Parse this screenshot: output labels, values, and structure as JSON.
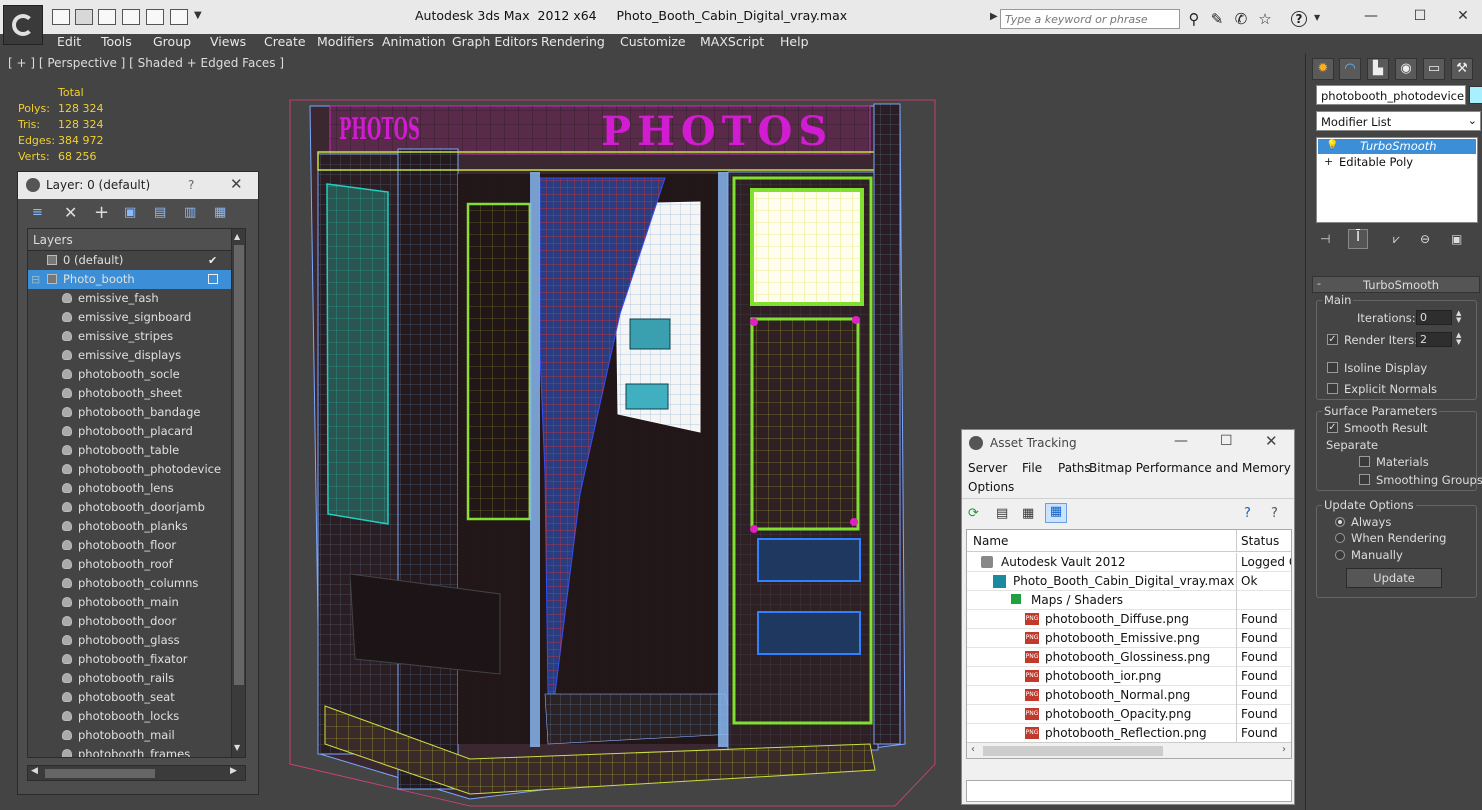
{
  "app": {
    "title_left": "Autodesk 3ds Max  2012 x64",
    "title_file": "Photo_Booth_Cabin_Digital_vray.max",
    "search_placeholder": "Type a keyword or phrase"
  },
  "menu": [
    "Edit",
    "Tools",
    "Group",
    "Views",
    "Create",
    "Modifiers",
    "Animation",
    "Graph Editors",
    "Rendering",
    "Customize",
    "MAXScript",
    "Help"
  ],
  "viewport": {
    "label": "[ + ] [ Perspective ] [ Shaded + Edged Faces ]",
    "stats": {
      "header": "Total",
      "rows": [
        {
          "label": "Polys:",
          "value": "128 324"
        },
        {
          "label": "Tris:",
          "value": "128 324"
        },
        {
          "label": "Edges:",
          "value": "384 972"
        },
        {
          "label": "Verts:",
          "value": "68 256"
        }
      ]
    },
    "sign_text": "PHOTOS",
    "side_sign_text": "PHOTOS"
  },
  "layer_panel": {
    "title": "Layer: 0 (default)",
    "help": "?",
    "column_header": "Layers",
    "rows": [
      {
        "label": "0 (default)",
        "level": 1
      },
      {
        "label": "Photo_booth",
        "level": 1
      },
      {
        "label": "emissive_fash",
        "level": 2
      },
      {
        "label": "emissive_signboard",
        "level": 2
      },
      {
        "label": "emissive_stripes",
        "level": 2
      },
      {
        "label": "emissive_displays",
        "level": 2
      },
      {
        "label": "photobooth_socle",
        "level": 2
      },
      {
        "label": "photobooth_sheet",
        "level": 2
      },
      {
        "label": "photobooth_bandage",
        "level": 2
      },
      {
        "label": "photobooth_placard",
        "level": 2
      },
      {
        "label": "photobooth_table",
        "level": 2
      },
      {
        "label": "photobooth_photodevice",
        "level": 2
      },
      {
        "label": "photobooth_lens",
        "level": 2
      },
      {
        "label": "photobooth_doorjamb",
        "level": 2
      },
      {
        "label": "photobooth_planks",
        "level": 2
      },
      {
        "label": "photobooth_floor",
        "level": 2
      },
      {
        "label": "photobooth_roof",
        "level": 2
      },
      {
        "label": "photobooth_columns",
        "level": 2
      },
      {
        "label": "photobooth_main",
        "level": 2
      },
      {
        "label": "photobooth_door",
        "level": 2
      },
      {
        "label": "photobooth_glass",
        "level": 2
      },
      {
        "label": "photobooth_fixator",
        "level": 2
      },
      {
        "label": "photobooth_rails",
        "level": 2
      },
      {
        "label": "photobooth_seat",
        "level": 2
      },
      {
        "label": "photobooth_locks",
        "level": 2
      },
      {
        "label": "photobooth_mail",
        "level": 2
      },
      {
        "label": "photobooth_frames",
        "level": 2
      }
    ],
    "selected_row": "Photo_booth"
  },
  "command_panel": {
    "object_name": "photobooth_photodevice",
    "modifier_list": "Modifier List",
    "stack": [
      "TurboSmooth",
      "Editable Poly"
    ],
    "rollout_title": "TurboSmooth",
    "main_label": "Main",
    "iterations_label": "Iterations:",
    "iterations_value": "0",
    "render_iters_label": "Render Iters:",
    "render_iters_value": "2",
    "render_iters_checked": true,
    "isoline_label": "Isoline Display",
    "explicit_normals_label": "Explicit Normals",
    "surface_params_label": "Surface Parameters",
    "smooth_result_label": "Smooth Result",
    "smooth_result_checked": true,
    "separate_label": "Separate",
    "materials_label": "Materials",
    "smoothing_groups_label": "Smoothing Groups",
    "update_options_label": "Update Options",
    "update_always": "Always",
    "update_when_rendering": "When Rendering",
    "update_manually": "Manually",
    "update_selected": "Always",
    "update_button": "Update"
  },
  "asset_tracking": {
    "title": "Asset Tracking",
    "menu": [
      "Server",
      "File",
      "Paths",
      "Bitmap Performance and Memory",
      "Options"
    ],
    "col_name": "Name",
    "col_status": "Status",
    "rows": [
      {
        "name": "Autodesk Vault 2012",
        "status": "Logged O",
        "indent": 1
      },
      {
        "name": "Photo_Booth_Cabin_Digital_vray.max",
        "status": "Ok",
        "indent": 2
      },
      {
        "name": "Maps / Shaders",
        "status": "",
        "indent": 3
      },
      {
        "name": "photobooth_Diffuse.png",
        "status": "Found",
        "indent": 4
      },
      {
        "name": "photobooth_Emissive.png",
        "status": "Found",
        "indent": 4
      },
      {
        "name": "photobooth_Glossiness.png",
        "status": "Found",
        "indent": 4
      },
      {
        "name": "photobooth_ior.png",
        "status": "Found",
        "indent": 4
      },
      {
        "name": "photobooth_Normal.png",
        "status": "Found",
        "indent": 4
      },
      {
        "name": "photobooth_Opacity.png",
        "status": "Found",
        "indent": 4
      },
      {
        "name": "photobooth_Reflection.png",
        "status": "Found",
        "indent": 4
      }
    ]
  },
  "colors": {
    "accent_blue": "#3399ff",
    "selection": "#3c8ed6",
    "stat_yellow": "#f0d030",
    "sign_magenta": "#d11cd1",
    "frame_green": "#7fe030"
  }
}
